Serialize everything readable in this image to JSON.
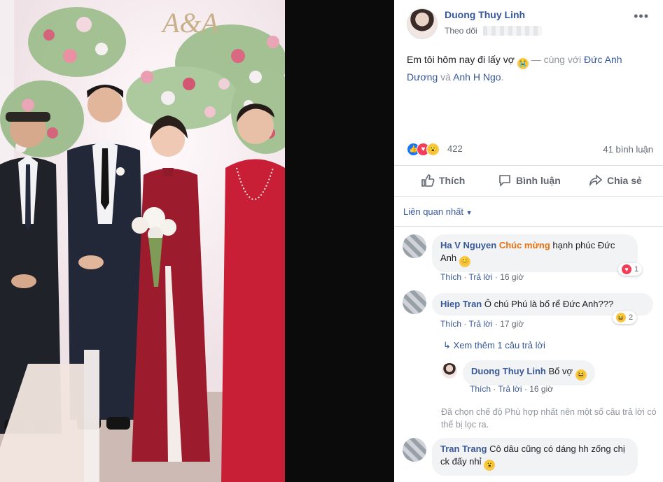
{
  "post": {
    "author": "Duong Thuy Linh",
    "follow_label": "Theo dõi",
    "more_icon": "more-dots-icon",
    "caption_text": "Em tôi hôm nay đi lấy vợ",
    "caption_emoji": "😭",
    "caption_with": "— cùng với",
    "tag_1": "Đức Anh Dương",
    "caption_and": "và",
    "tag_2": "Anh H Ngo",
    "reaction_count": "422",
    "comment_count": "41 bình luận",
    "photo_sign": "A&A"
  },
  "actions": {
    "like": "Thích",
    "comment": "Bình luận",
    "share": "Chia sẻ"
  },
  "sort_label": "Liên quan nhất",
  "comments": [
    {
      "name": "Ha V Nguyen",
      "highlight": "Chúc mừng",
      "text": "hạnh phúc Đức Anh",
      "emoji": "😊",
      "like": "Thích",
      "reply": "Trả lời",
      "time": "16 giờ",
      "reaction_count": "1"
    },
    {
      "name": "Hiep Tran",
      "text": "Ô chú Phú là bố rể Đức Anh???",
      "like": "Thích",
      "reply": "Trả lời",
      "time": "17 giờ",
      "reaction_count": "2",
      "more_replies": "Xem thêm 1 câu trả lời"
    },
    {
      "name": "Tran Trang",
      "text": "Cô dâu cũng có dáng hh zống chị ck đấy nhỉ",
      "emoji": "😮"
    }
  ],
  "reply": {
    "name": "Duong Thuy Linh",
    "text": "Bố vợ",
    "emoji": "😆",
    "like": "Thích",
    "reply": "Trả lời",
    "time": "16 giờ"
  },
  "filter_notice": "Đã chọn chế độ Phù hợp nhất nên một số câu trả lời có thể bị lọc ra.",
  "colors": {
    "link": "#365899",
    "muted": "#90949c",
    "like": "#1877f2",
    "love": "#f33e58",
    "wow": "#f7c948"
  }
}
